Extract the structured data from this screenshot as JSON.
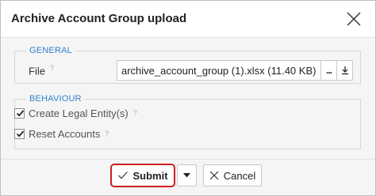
{
  "dialog": {
    "title": "Archive Account Group upload"
  },
  "general": {
    "legend": "GENERAL",
    "file_label": "File",
    "help_mark": "?",
    "file_value": "archive_account_group (1).xlsx (11.40 KB)",
    "browse_label": "..."
  },
  "behaviour": {
    "legend": "BEHAVIOUR",
    "help_mark": "?",
    "options": [
      {
        "label": "Create Legal Entity(s)",
        "checked": true
      },
      {
        "label": "Reset Accounts",
        "checked": true
      }
    ]
  },
  "footer": {
    "submit_label": "Submit",
    "cancel_label": "Cancel"
  },
  "colors": {
    "accent": "#2f7fd1",
    "highlight": "#cc1f1f"
  },
  "icons": {
    "close": "close-icon",
    "download": "download-icon",
    "check": "checkmark-icon",
    "dropdown": "caret-down-icon",
    "cancel": "x-icon"
  }
}
